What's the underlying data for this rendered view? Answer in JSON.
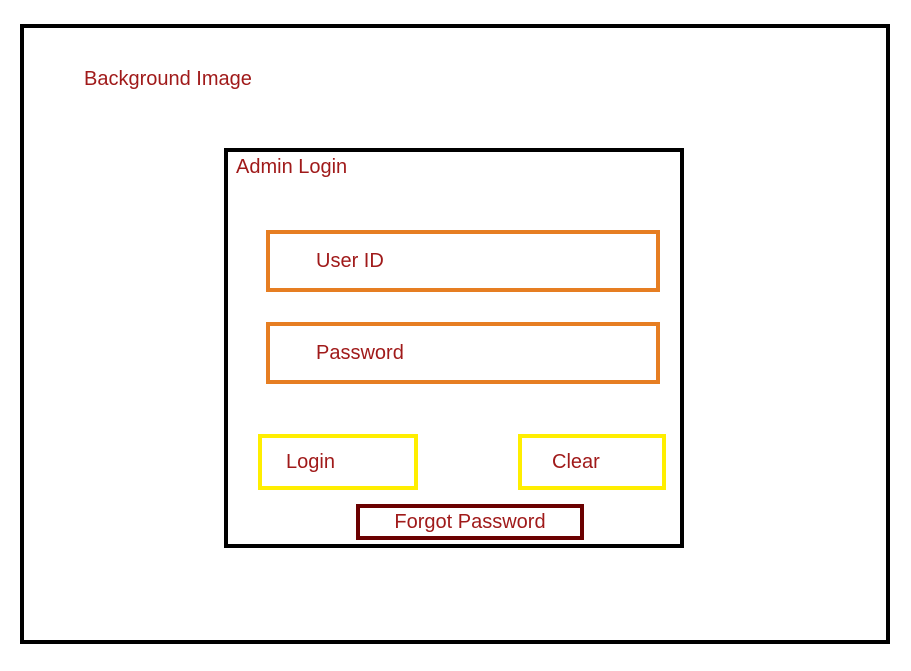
{
  "background_label": "Background Image",
  "panel": {
    "title": "Admin Login",
    "user_id_placeholder": "User ID",
    "password_placeholder": "Password",
    "login_label": "Login",
    "clear_label": "Clear",
    "forgot_label": "Forgot Password"
  },
  "colors": {
    "text": "#a01a1a",
    "frame_border": "#000000",
    "field_border": "#e67e22",
    "button_border": "#ffee00",
    "forgot_border": "#6b0000"
  }
}
